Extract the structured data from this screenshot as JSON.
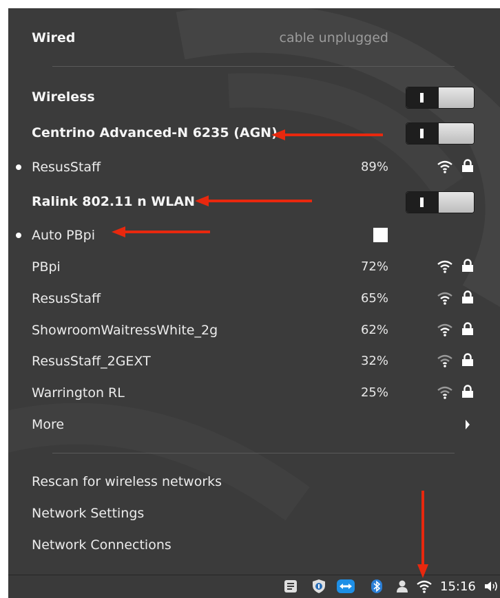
{
  "menu": {
    "wired": {
      "label": "Wired",
      "status": "cable unplugged"
    },
    "wireless": {
      "label": "Wireless"
    },
    "adapter1": {
      "label": "Centrino Advanced-N 6235 (AGN)"
    },
    "adapter1_networks": [
      {
        "name": "ResusStaff",
        "signal": "89%",
        "connected": true
      }
    ],
    "adapter2": {
      "label": "Ralink 802.11 n WLAN"
    },
    "adapter2_connected": {
      "name": "Auto PBpi"
    },
    "networks": [
      {
        "name": "PBpi",
        "signal": "72%"
      },
      {
        "name": "ResusStaff",
        "signal": "65%"
      },
      {
        "name": "ShowroomWaitressWhite_2g",
        "signal": "62%"
      },
      {
        "name": "ResusStaff_2GEXT",
        "signal": "32%"
      },
      {
        "name": "Warrington RL",
        "signal": "25%"
      }
    ],
    "more_label": "More",
    "actions": {
      "rescan": "Rescan for wireless networks",
      "settings": "Network Settings",
      "connections": "Network Connections"
    }
  },
  "taskbar": {
    "clock": "15:16",
    "tray_icons": [
      "notes-icon",
      "shield-icon",
      "teamviewer-icon",
      "bluetooth-icon",
      "user-icon",
      "wifi-icon",
      "volume-icon"
    ]
  },
  "colors": {
    "menu_bg": "#3b3b3b",
    "annotation_arrow": "#e8280e"
  }
}
